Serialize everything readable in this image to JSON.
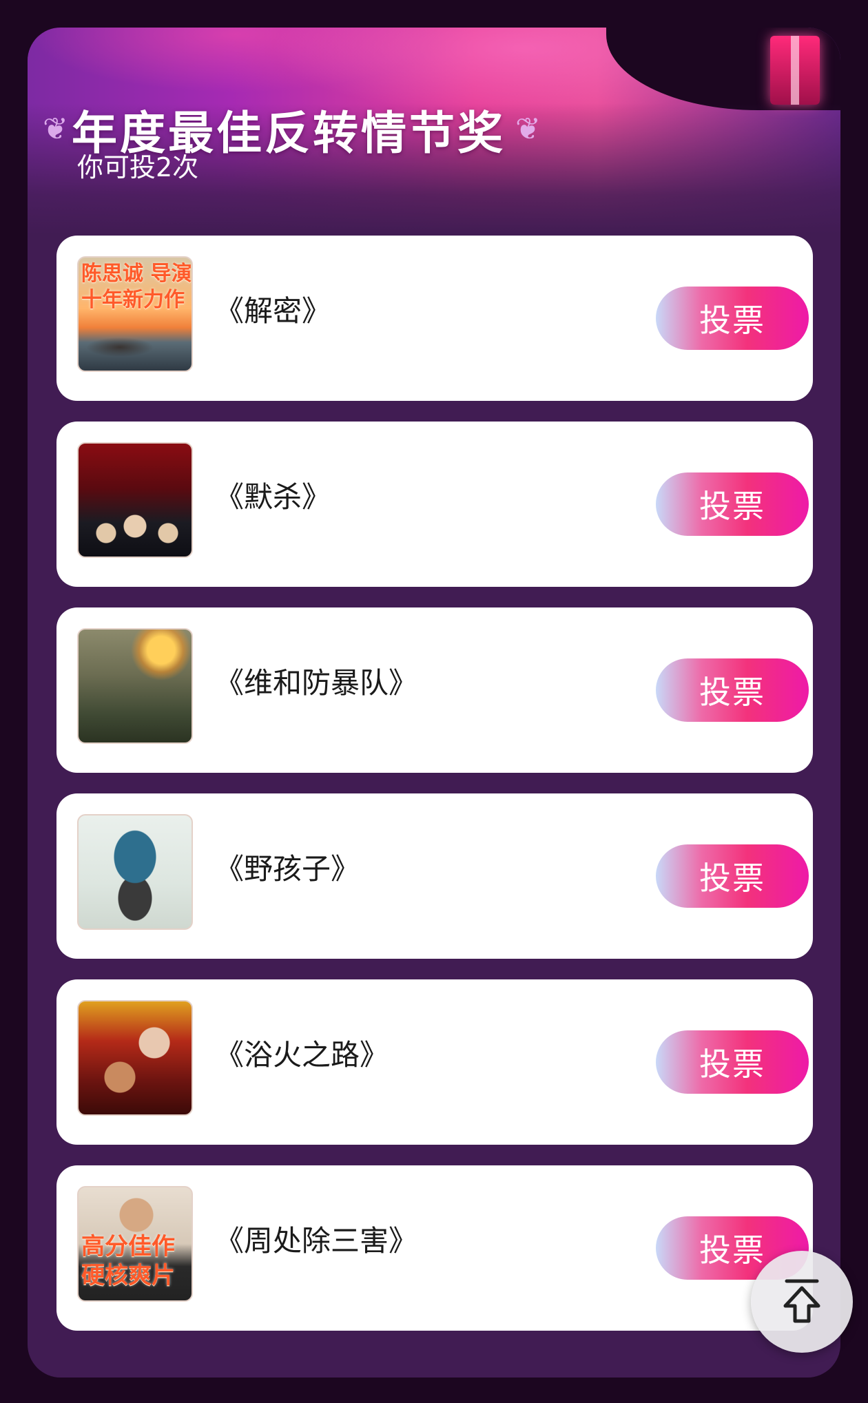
{
  "header": {
    "title": "年度最佳反转情节奖",
    "votes_left": "你可投2次"
  },
  "nominees": [
    {
      "name": "《解密》",
      "poster_text": [
        "陈思诚 导演",
        "十年新力作"
      ],
      "vote_label": "投票"
    },
    {
      "name": "《默杀》",
      "poster_text": [],
      "vote_label": "投票"
    },
    {
      "name": "《维和防暴队》",
      "poster_text": [],
      "vote_label": "投票"
    },
    {
      "name": "《野孩子》",
      "poster_text": [],
      "vote_label": "投票"
    },
    {
      "name": "《浴火之路》",
      "poster_text": [],
      "vote_label": "投票"
    },
    {
      "name": "《周处除三害》",
      "poster_text": [
        "高分佳作",
        "硬核爽片"
      ],
      "vote_label": "投票"
    }
  ],
  "icons": {
    "back_to_top": "arrow-up-to-line-icon",
    "laurel": "laurel-icon"
  },
  "colors": {
    "panel": "#411c53",
    "page": "#1c0620",
    "vote_gradient_end": "#f3327c"
  }
}
